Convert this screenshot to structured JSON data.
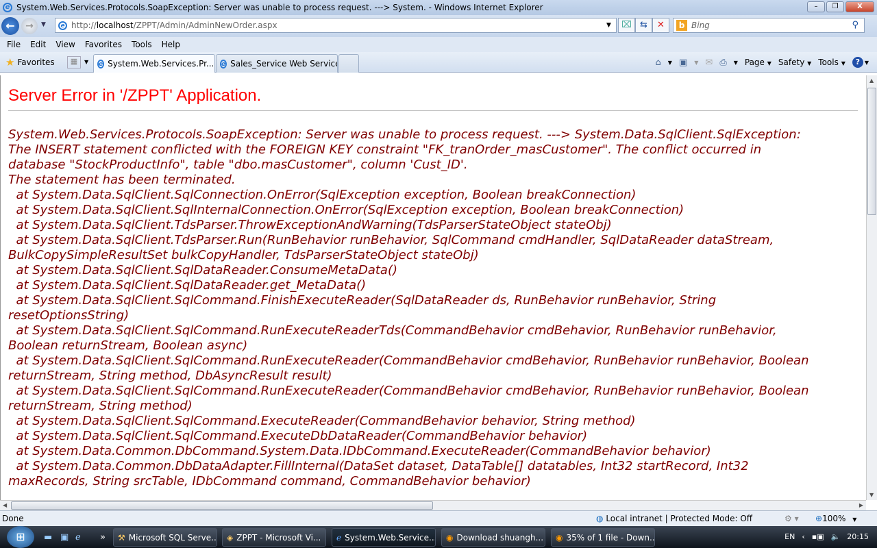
{
  "window": {
    "title": "System.Web.Services.Protocols.SoapException: Server was unable to process request. ---> System. - Windows Internet Explorer",
    "minimize": "–",
    "restore": "❐",
    "close": "X"
  },
  "address": {
    "prefix": "http://",
    "host": "localhost",
    "path": "/ZPPT/Admin/AdminNewOrder.aspx"
  },
  "search": {
    "placeholder": "Bing"
  },
  "menu": [
    "File",
    "Edit",
    "View",
    "Favorites",
    "Tools",
    "Help"
  ],
  "favorites_label": "Favorites",
  "tabs": [
    {
      "label": "System.Web.Services.Pr...",
      "active": true
    },
    {
      "label": "Sales_Service Web Service",
      "active": false
    }
  ],
  "commands": {
    "page": "Page",
    "safety": "Safety",
    "tools": "Tools"
  },
  "page": {
    "title": "Server Error in '/ZPPT' Application.",
    "lines": [
      "System.Web.Services.Protocols.SoapException: Server was unable to process request. ---> System.Data.SqlClient.SqlException:",
      "The INSERT statement conflicted with the FOREIGN KEY constraint \"FK_tranOrder_masCustomer\". The conflict occurred in",
      "database \"StockProductInfo\", table \"dbo.masCustomer\", column 'Cust_ID'.",
      "The statement has been terminated.",
      "  at System.Data.SqlClient.SqlConnection.OnError(SqlException exception, Boolean breakConnection)",
      "  at System.Data.SqlClient.SqlInternalConnection.OnError(SqlException exception, Boolean breakConnection)",
      "  at System.Data.SqlClient.TdsParser.ThrowExceptionAndWarning(TdsParserStateObject stateObj)",
      "  at System.Data.SqlClient.TdsParser.Run(RunBehavior runBehavior, SqlCommand cmdHandler, SqlDataReader dataStream,",
      "BulkCopySimpleResultSet bulkCopyHandler, TdsParserStateObject stateObj)",
      "  at System.Data.SqlClient.SqlDataReader.ConsumeMetaData()",
      "  at System.Data.SqlClient.SqlDataReader.get_MetaData()",
      "  at System.Data.SqlClient.SqlCommand.FinishExecuteReader(SqlDataReader ds, RunBehavior runBehavior, String",
      "resetOptionsString)",
      "  at System.Data.SqlClient.SqlCommand.RunExecuteReaderTds(CommandBehavior cmdBehavior, RunBehavior runBehavior,",
      "Boolean returnStream, Boolean async)",
      "  at System.Data.SqlClient.SqlCommand.RunExecuteReader(CommandBehavior cmdBehavior, RunBehavior runBehavior, Boolean",
      "returnStream, String method, DbAsyncResult result)",
      "  at System.Data.SqlClient.SqlCommand.RunExecuteReader(CommandBehavior cmdBehavior, RunBehavior runBehavior, Boolean",
      "returnStream, String method)",
      "  at System.Data.SqlClient.SqlCommand.ExecuteReader(CommandBehavior behavior, String method)",
      "  at System.Data.SqlClient.SqlCommand.ExecuteDbDataReader(CommandBehavior behavior)",
      "  at System.Data.Common.DbCommand.System.Data.IDbCommand.ExecuteReader(CommandBehavior behavior)",
      "  at System.Data.Common.DbDataAdapter.FillInternal(DataSet dataset, DataTable[] datatables, Int32 startRecord, Int32",
      "maxRecords, String srcTable, IDbCommand command, CommandBehavior behavior)"
    ]
  },
  "status": {
    "text": "Done",
    "zone": "Local intranet | Protected Mode: Off",
    "zoom": "100%"
  },
  "taskbar": {
    "items": [
      "Microsoft SQL Serve...",
      "ZPPT - Microsoft Vi...",
      "System.Web.Service...",
      "Download shuangh...",
      "35% of 1 file - Down..."
    ],
    "lang": "EN",
    "time": "20:15"
  }
}
